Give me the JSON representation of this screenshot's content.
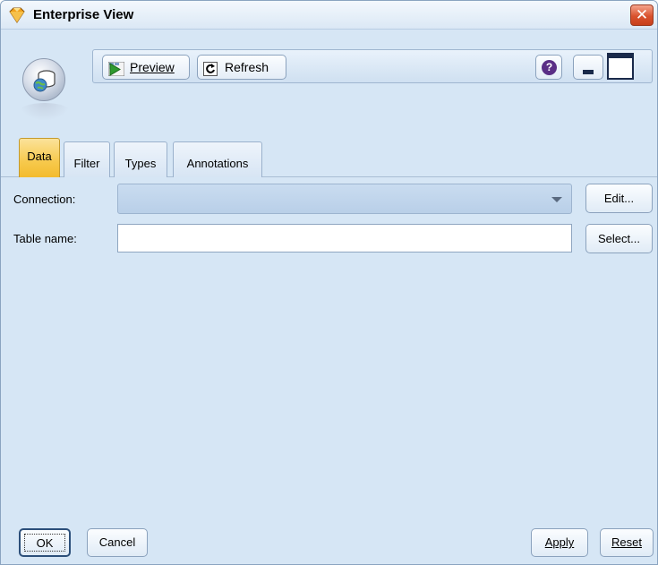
{
  "window": {
    "title": "Enterprise View",
    "close_label": "✕"
  },
  "toolbar": {
    "preview_label": "Preview",
    "refresh_label": "Refresh",
    "help_label": "?"
  },
  "tabs": [
    {
      "label": "Data",
      "active": true
    },
    {
      "label": "Filter",
      "active": false
    },
    {
      "label": "Types",
      "active": false
    },
    {
      "label": "Annotations",
      "active": false
    }
  ],
  "form": {
    "connection_label": "Connection:",
    "connection_value": "",
    "edit_label": "Edit...",
    "table_name_label": "Table name:",
    "table_name_value": "",
    "select_label": "Select..."
  },
  "buttons": {
    "ok_label": "OK",
    "cancel_label": "Cancel",
    "apply_label": "Apply",
    "reset_label": "Reset"
  },
  "icons": {
    "title": "diamond-node-icon",
    "node": "database-globe-icon",
    "preview": "preview-play-icon",
    "refresh": "refresh-icon",
    "help": "help-icon",
    "minimize": "minimize-icon",
    "maximize": "maximize-icon"
  },
  "colors": {
    "background": "#d6e6f5",
    "active_tab": "#f7c94c",
    "close_button": "#d9522e",
    "help_icon": "#5a2e86"
  }
}
